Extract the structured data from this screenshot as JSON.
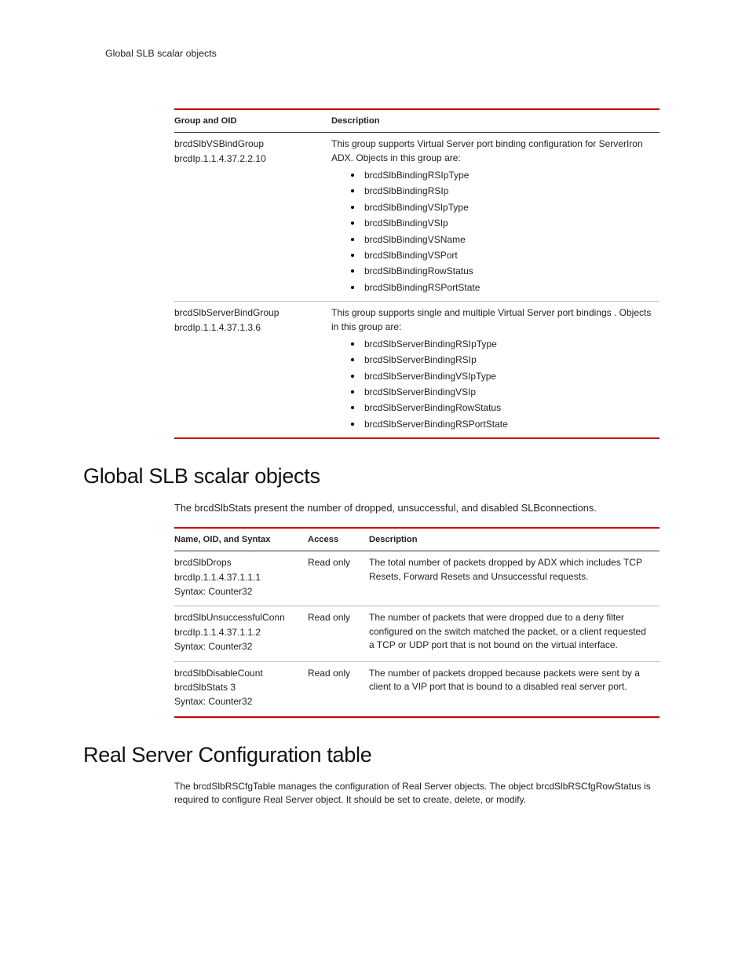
{
  "pageHeader": "Global SLB scalar objects",
  "table1": {
    "headers": {
      "col1": "Group and OID",
      "col2": "Description"
    },
    "rows": [
      {
        "group": [
          "brcdSlbVSBindGroup",
          "brcdIp.1.1.4.37.2.2.10"
        ],
        "descIntro": "This group supports Virtual Server port binding configuration for ServerIron ADX. Objects in this group are:",
        "bullets": [
          "brcdSlbBindingRSIpType",
          "brcdSlbBindingRSIp",
          "brcdSlbBindingVSIpType",
          "brcdSlbBindingVSIp",
          "brcdSlbBindingVSName",
          "brcdSlbBindingVSPort",
          "brcdSlbBindingRowStatus",
          "brcdSlbBindingRSPortState"
        ]
      },
      {
        "group": [
          "brcdSlbServerBindGroup",
          "brcdIp.1.1.4.37.1.3.6"
        ],
        "descIntro": "This group supports single and multiple Virtual Server port bindings . Objects in this group are:",
        "bullets": [
          "brcdSlbServerBindingRSIpType",
          "brcdSlbServerBindingRSIp",
          "brcdSlbServerBindingVSIpType",
          "brcdSlbServerBindingVSIp",
          "brcdSlbServerBindingRowStatus",
          "brcdSlbServerBindingRSPortState"
        ]
      }
    ]
  },
  "section1": {
    "heading": "Global SLB scalar objects",
    "intro": "The brcdSlbStats present the number of dropped, unsuccessful, and disabled SLBconnections."
  },
  "table2": {
    "headers": {
      "col1": "Name, OID, and Syntax",
      "col2": "Access",
      "col3": "Description"
    },
    "rows": [
      {
        "name": [
          "brcdSlbDrops",
          "brcdIp.1.1.4.37.1.1.1",
          "Syntax: Counter32"
        ],
        "access": "Read only",
        "desc": "The total number of packets dropped by ADX which includes TCP Resets, Forward Resets and Unsuccessful requests."
      },
      {
        "name": [
          "brcdSlbUnsuccessfulConn",
          "brcdIp.1.1.4.37.1.1.2",
          "Syntax: Counter32"
        ],
        "access": "Read only",
        "desc": "The number of packets that were dropped due to a deny filter configured on the switch matched the packet, or a client requested a TCP or UDP port that is not bound on the virtual interface."
      },
      {
        "name": [
          "brcdSlbDisableCount",
          "brcdSlbStats 3",
          "Syntax: Counter32"
        ],
        "access": "Read only",
        "desc": "The number of packets dropped because packets were sent by a client to a VIP port that is bound to a disabled real server port."
      }
    ]
  },
  "section2": {
    "heading": "Real Server Configuration table",
    "intro": "The brcdSlbRSCfgTable manages the configuration of Real Server objects. The object brcdSlbRSCfgRowStatus is required to configure Real Server object. It should be set to create, delete, or modify."
  }
}
